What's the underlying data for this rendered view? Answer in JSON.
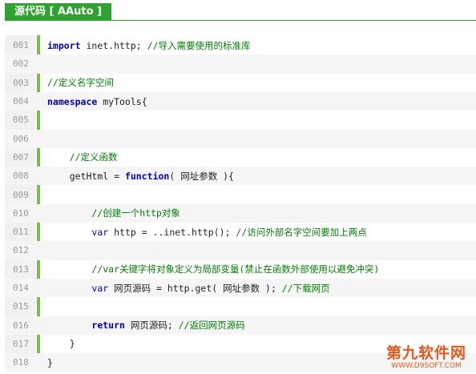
{
  "header": {
    "title": "源代码 [ AAuto ]"
  },
  "code_lines": [
    {
      "num": "001",
      "indent": "",
      "tokens": [
        {
          "t": "import",
          "c": "kw"
        },
        {
          "t": " inet.http; ",
          "c": ""
        },
        {
          "t": "//导入需要使用的标准库",
          "c": "cm"
        }
      ]
    },
    {
      "num": "002",
      "indent": "",
      "tokens": []
    },
    {
      "num": "003",
      "indent": "",
      "tokens": [
        {
          "t": "//定义名字空间",
          "c": "cm"
        }
      ]
    },
    {
      "num": "004",
      "indent": "",
      "tokens": [
        {
          "t": "namespace",
          "c": "kw"
        },
        {
          "t": " myTools{",
          "c": ""
        }
      ]
    },
    {
      "num": "005",
      "indent": "",
      "tokens": []
    },
    {
      "num": "006",
      "indent": "",
      "tokens": []
    },
    {
      "num": "007",
      "indent": "    ",
      "tokens": [
        {
          "t": "//定义函数",
          "c": "cm"
        }
      ]
    },
    {
      "num": "008",
      "indent": "    ",
      "tokens": [
        {
          "t": "getHtml = ",
          "c": ""
        },
        {
          "t": "function",
          "c": "kw"
        },
        {
          "t": "( 网址参数 ){",
          "c": ""
        }
      ]
    },
    {
      "num": "009",
      "indent": "",
      "tokens": []
    },
    {
      "num": "010",
      "indent": "        ",
      "tokens": [
        {
          "t": "//创建一个http对象",
          "c": "cm"
        }
      ]
    },
    {
      "num": "011",
      "indent": "        ",
      "tokens": [
        {
          "t": "var",
          "c": "kw2"
        },
        {
          "t": " http = ..inet.http(); ",
          "c": ""
        },
        {
          "t": "//访问外部名字空间要加上两点",
          "c": "cm"
        }
      ]
    },
    {
      "num": "012",
      "indent": "",
      "tokens": []
    },
    {
      "num": "013",
      "indent": "        ",
      "tokens": [
        {
          "t": "//var关键字将对象定义为局部变量(禁止在函数外部使用以避免冲突)",
          "c": "cm"
        }
      ]
    },
    {
      "num": "014",
      "indent": "        ",
      "tokens": [
        {
          "t": "var",
          "c": "kw2"
        },
        {
          "t": " 网页源码 = http.get( 网址参数 ); ",
          "c": ""
        },
        {
          "t": "//下载网页",
          "c": "cm"
        }
      ]
    },
    {
      "num": "015",
      "indent": "",
      "tokens": []
    },
    {
      "num": "016",
      "indent": "        ",
      "tokens": [
        {
          "t": "return",
          "c": "kw"
        },
        {
          "t": " 网页源码; ",
          "c": ""
        },
        {
          "t": "//返回网页源码",
          "c": "cm"
        }
      ]
    },
    {
      "num": "017",
      "indent": "    ",
      "tokens": [
        {
          "t": "}",
          "c": ""
        }
      ]
    },
    {
      "num": "018",
      "indent": "",
      "tokens": [
        {
          "t": "}",
          "c": ""
        }
      ]
    }
  ],
  "watermark": {
    "top": "第九软件网",
    "bottom": "WWW.D9SOFT.COM"
  },
  "colors": {
    "accent": "#2fa32f",
    "gutter_bar": "#77c046",
    "keyword": "#0000cc",
    "comment": "#008000",
    "watermark": "#e8571a"
  }
}
